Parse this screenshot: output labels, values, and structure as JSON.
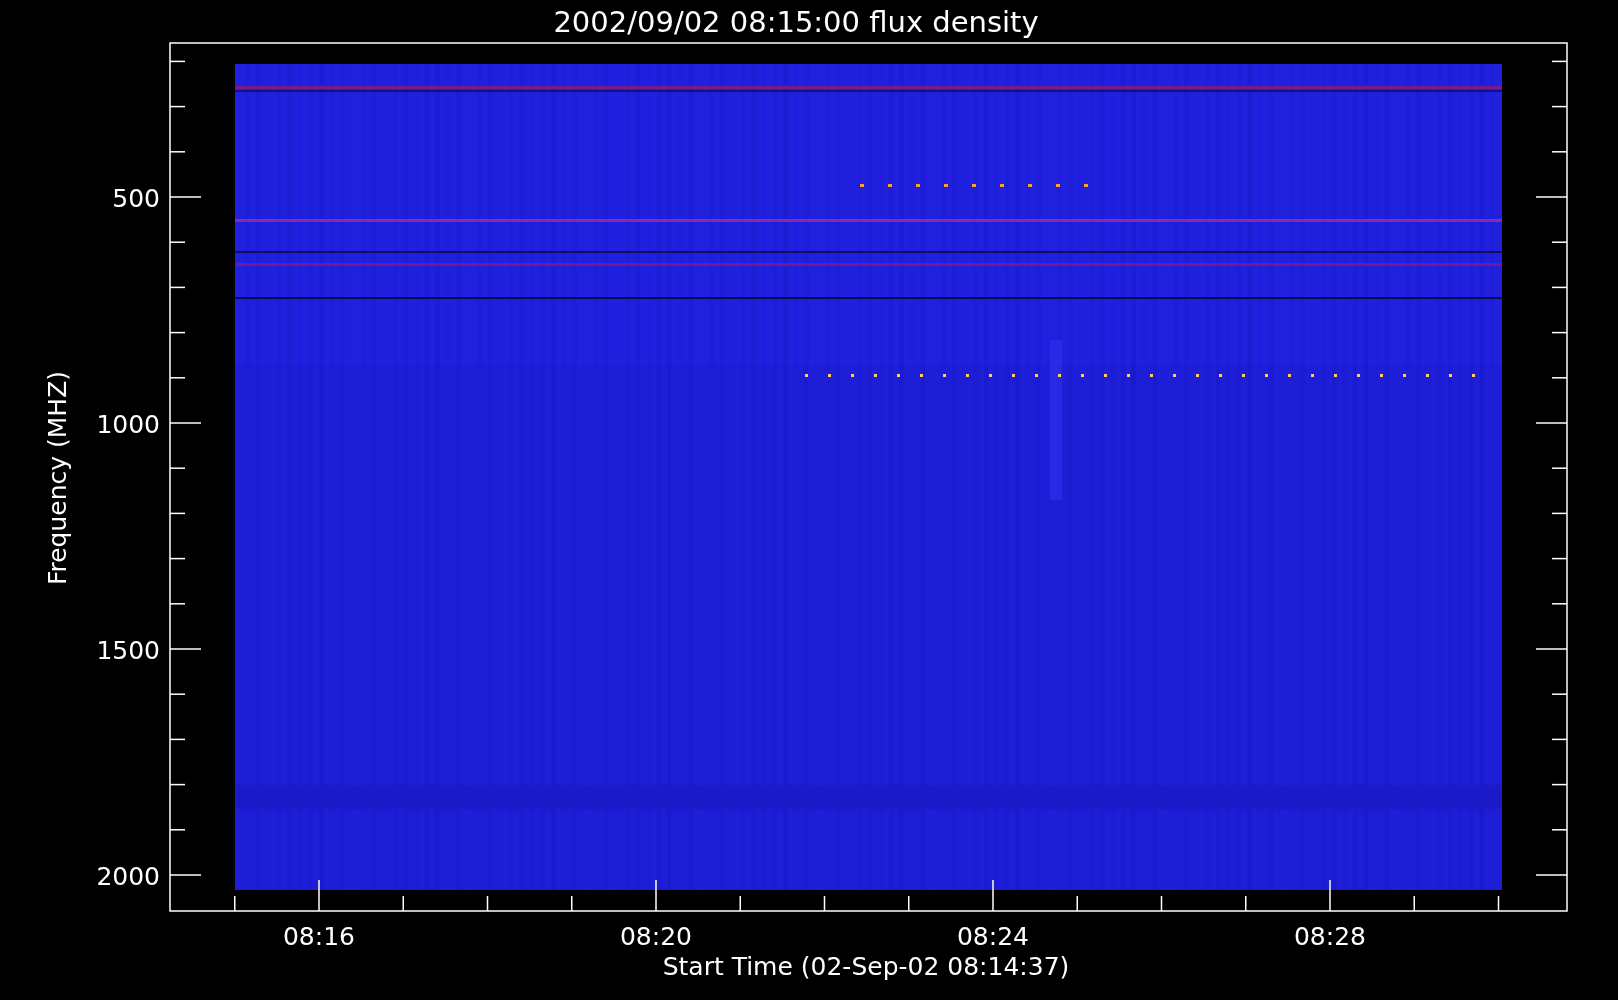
{
  "title": "2002/09/02 08:15:00 flux density",
  "y_axis": {
    "label": "Frequency (MHZ)",
    "ticks": [
      "500",
      "1000",
      "1500",
      "2000"
    ]
  },
  "x_axis": {
    "label": "Start Time (02-Sep-02 08:14:37)",
    "ticks": [
      "08:16",
      "08:20",
      "08:24",
      "08:28"
    ]
  }
}
